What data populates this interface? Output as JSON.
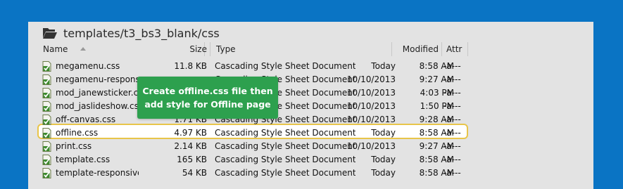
{
  "window": {
    "path": "templates/t3_bs3_blank/css",
    "folder_icon": "folder-open-icon"
  },
  "columns": {
    "name": "Name",
    "size": "Size",
    "type": "Type",
    "modified": "Modified",
    "attr": "Attr"
  },
  "files": [
    {
      "name": "megamenu.css",
      "size": "11.8 KB",
      "type": "Cascading Style Sheet Document",
      "date": "Today",
      "time": "8:58 AM",
      "attr": "-a---"
    },
    {
      "name": "megamenu-responsive.css",
      "size": "",
      "type": "Cascading Style Sheet Document",
      "date": "10/10/2013",
      "time": "9:27 AM",
      "attr": "-a---"
    },
    {
      "name": "mod_janewsticker.css",
      "size": "",
      "type": "Cascading Style Sheet Document",
      "date": "10/10/2013",
      "time": "4:03 PM",
      "attr": "-a---"
    },
    {
      "name": "mod_jaslideshow.css",
      "size": "",
      "type": "Cascading Style Sheet Document",
      "date": "10/10/2013",
      "time": "1:50 PM",
      "attr": "-a---"
    },
    {
      "name": "off-canvas.css",
      "size": "1.71 KB",
      "type": "Cascading Style Sheet Document",
      "date": "10/10/2013",
      "time": "9:28 AM",
      "attr": "-a---"
    },
    {
      "name": "offline.css",
      "size": "4.97 KB",
      "type": "Cascading Style Sheet Document",
      "date": "Today",
      "time": "8:58 AM",
      "attr": "-a---"
    },
    {
      "name": "print.css",
      "size": "2.14 KB",
      "type": "Cascading Style Sheet Document",
      "date": "10/10/2013",
      "time": "9:27 AM",
      "attr": "-a---"
    },
    {
      "name": "template.css",
      "size": "165 KB",
      "type": "Cascading Style Sheet Document",
      "date": "Today",
      "time": "8:58 AM",
      "attr": "-a---"
    },
    {
      "name": "template-responsive.css",
      "size": "54 KB",
      "type": "Cascading Style Sheet Document",
      "date": "Today",
      "time": "8:58 AM",
      "attr": "-a---"
    }
  ],
  "file_icon": "css-file-check-icon",
  "tooltip": {
    "line1": "Create offline.css file then",
    "line2": "add style for Offline page"
  },
  "colors": {
    "background": "#0a74c4",
    "tooltip": "#2da04e",
    "highlight_border": "#e8c54a"
  }
}
